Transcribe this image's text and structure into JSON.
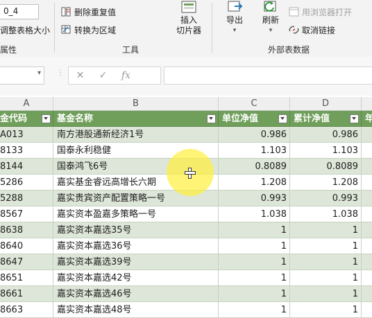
{
  "ribbon": {
    "table_name_value": "0_4",
    "resize_table_label": "调整表格大小",
    "properties_group": "属性",
    "remove_duplicates_label": "删除重复值",
    "convert_to_range_label": "转换为区域",
    "insert_slicer_label_1": "插入",
    "insert_slicer_label_2": "切片器",
    "tools_group": "工具",
    "export_label": "导出",
    "refresh_label": "刷新",
    "open_in_browser_label": "用浏览器打开",
    "unlink_label": "取消链接",
    "external_data_group": "外部表数据"
  },
  "formula_bar": {
    "cancel_glyph": "✕",
    "confirm_glyph": "✓",
    "fx_glyph": "fx"
  },
  "columns": {
    "A": "A",
    "B": "B",
    "C": "C",
    "D": "D",
    "E": ""
  },
  "table": {
    "headers": {
      "code": "金代码",
      "name": "基金名称",
      "unit_nav": "单位净值",
      "cum_nav": "累计净值",
      "extra": "年"
    },
    "rows": [
      {
        "code": "A013",
        "name": "南方港股通新经济1号",
        "unit": "0.986",
        "cum": "0.986"
      },
      {
        "code": "8133",
        "name": "国泰永利稳健",
        "unit": "1.103",
        "cum": "1.103"
      },
      {
        "code": "8144",
        "name": "国泰鸿飞6号",
        "unit": "0.8089",
        "cum": "0.8089"
      },
      {
        "code": "5286",
        "name": "嘉实基金睿远高增长六期",
        "unit": "1.208",
        "cum": "1.208"
      },
      {
        "code": "5288",
        "name": "嘉实贵宾资产配置策略一号",
        "unit": "0.993",
        "cum": "0.993"
      },
      {
        "code": "8567",
        "name": "嘉实资本盈嘉多策略一号",
        "unit": "1.038",
        "cum": "1.038"
      },
      {
        "code": "8638",
        "name": "嘉实资本嘉选35号",
        "unit": "1",
        "cum": "1"
      },
      {
        "code": "8640",
        "name": "嘉实资本嘉选36号",
        "unit": "1",
        "cum": "1"
      },
      {
        "code": "8647",
        "name": "嘉实资本嘉选39号",
        "unit": "1",
        "cum": "1"
      },
      {
        "code": "8651",
        "name": "嘉实资本嘉选42号",
        "unit": "1",
        "cum": "1"
      },
      {
        "code": "8661",
        "name": "嘉实资本嘉选46号",
        "unit": "1",
        "cum": "1"
      },
      {
        "code": "8663",
        "name": "嘉实资本嘉选48号",
        "unit": "1",
        "cum": "1"
      }
    ]
  },
  "colors": {
    "header_fill": "#6f9f5a",
    "band_fill": "#dde6d8",
    "cursor_highlight": "#fff03c"
  }
}
